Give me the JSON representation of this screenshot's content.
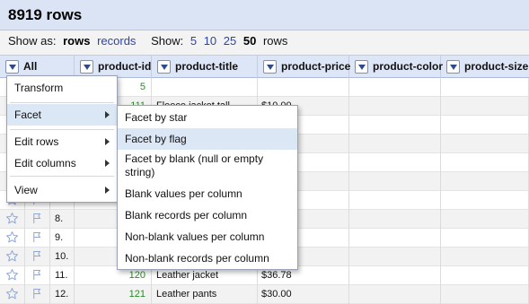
{
  "header": {
    "row_count": "8919 rows"
  },
  "viewbar": {
    "show_as_label": "Show as:",
    "rows_label": "rows",
    "records_label": "records",
    "show_label": "Show:",
    "page_sizes": [
      "5",
      "10",
      "25",
      "50"
    ],
    "active_page_size": "50",
    "rows_suffix": "rows"
  },
  "columns": [
    "All",
    "product-id",
    "product-title",
    "product-price",
    "product-color",
    "product-size"
  ],
  "rows": [
    {
      "num": "",
      "id": "5",
      "title": "",
      "price": ""
    },
    {
      "num": "",
      "id": "111",
      "title": "Fleece jacket tall",
      "price": "$10.00"
    },
    {
      "num": "",
      "id": "",
      "title": "",
      "price": ""
    },
    {
      "num": "",
      "id": "",
      "title": "",
      "price": ""
    },
    {
      "num": "",
      "id": "",
      "title": "",
      "price": ""
    },
    {
      "num": "",
      "id": "",
      "title": "",
      "price": ""
    },
    {
      "num": "7.",
      "id": "",
      "title": "",
      "price": ""
    },
    {
      "num": "8.",
      "id": "",
      "title": "",
      "price": ""
    },
    {
      "num": "9.",
      "id": "",
      "title": "",
      "price": ""
    },
    {
      "num": "10.",
      "id": "",
      "title": "",
      "price": ""
    },
    {
      "num": "11.",
      "id": "120",
      "title": "Leather jacket",
      "price": "$36.78"
    },
    {
      "num": "12.",
      "id": "121",
      "title": "Leather pants",
      "price": "$30.00"
    }
  ],
  "menu": {
    "items": [
      {
        "label": "Transform",
        "has_submenu": false
      },
      {
        "label": "Facet",
        "has_submenu": true,
        "highlighted": true
      },
      {
        "label": "Edit rows",
        "has_submenu": true
      },
      {
        "label": "Edit columns",
        "has_submenu": true
      },
      {
        "label": "View",
        "has_submenu": true
      }
    ]
  },
  "facet_submenu": {
    "items": [
      {
        "label": "Facet by star"
      },
      {
        "label": "Facet by flag",
        "highlighted": true
      },
      {
        "label": "Facet by blank (null or empty string)"
      },
      {
        "label": "Blank values per column"
      },
      {
        "label": "Blank records per column"
      },
      {
        "label": "Non-blank values per column"
      },
      {
        "label": "Non-blank records per column"
      }
    ]
  },
  "colors": {
    "header_bg": "#dbe4f5",
    "link": "#2c44a8",
    "id_green": "#2a8a2a",
    "menu_highlight": "#dce7f6",
    "icon_blue": "#8fa6d4"
  },
  "icons": {
    "star": "star-icon",
    "flag": "flag-icon",
    "dropdown": "dropdown-arrow-icon"
  }
}
